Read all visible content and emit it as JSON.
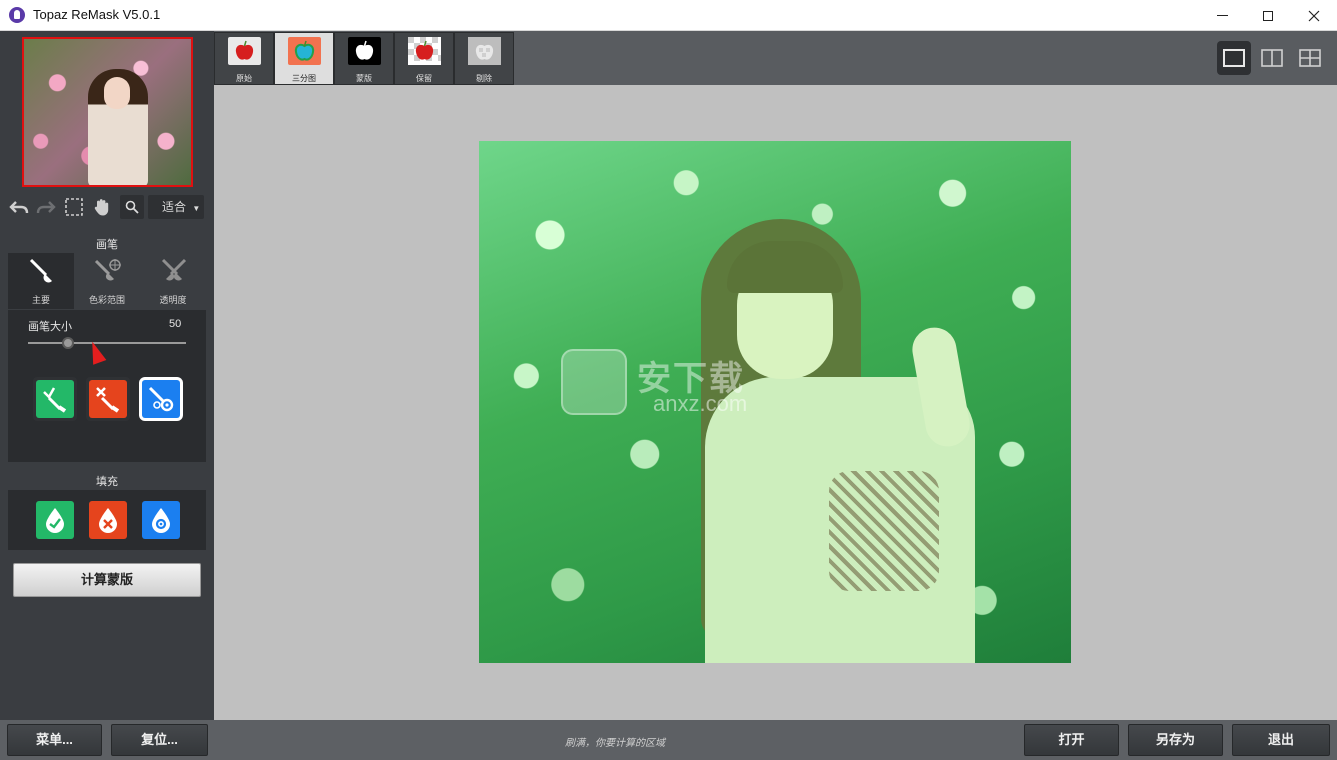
{
  "window": {
    "title": "Topaz ReMask V5.0.1"
  },
  "left_panel": {
    "fit_select": "适合",
    "brush_section_label": "画笔",
    "brush_tabs": [
      {
        "label": "主要",
        "icon": "brush-icon",
        "active": true
      },
      {
        "label": "色彩范围",
        "icon": "color-range-brush-icon",
        "active": false
      },
      {
        "label": "透明度",
        "icon": "transparency-brush-icon",
        "active": false
      }
    ],
    "brush_size_label": "画笔大小",
    "brush_size_value": "50",
    "brush_size_level": 0.25,
    "fill_section_label": "填充",
    "compute_button": "计算蒙版"
  },
  "view_tabs": [
    {
      "label": "原始",
      "icon": "apple-red-icon"
    },
    {
      "label": "三分图",
      "icon": "apple-trimap-icon"
    },
    {
      "label": "蒙版",
      "icon": "apple-mask-icon"
    },
    {
      "label": "保留",
      "icon": "apple-keep-icon"
    },
    {
      "label": "剔除",
      "icon": "apple-cut-icon"
    }
  ],
  "active_view_tab": 1,
  "canvas": {
    "watermark_main": "安下载",
    "watermark_sub": "anxz.com"
  },
  "bottom_bar": {
    "menu_button": "菜单...",
    "reset_button": "复位...",
    "hint": "刷满，你要计算的区域",
    "open_button": "打开",
    "save_as_button": "另存为",
    "exit_button": "退出"
  },
  "colors": {
    "keep_green": "#23b868",
    "cut_red": "#e5441d",
    "compute_blue": "#1b7ff0",
    "selection_red": "#e01010"
  }
}
